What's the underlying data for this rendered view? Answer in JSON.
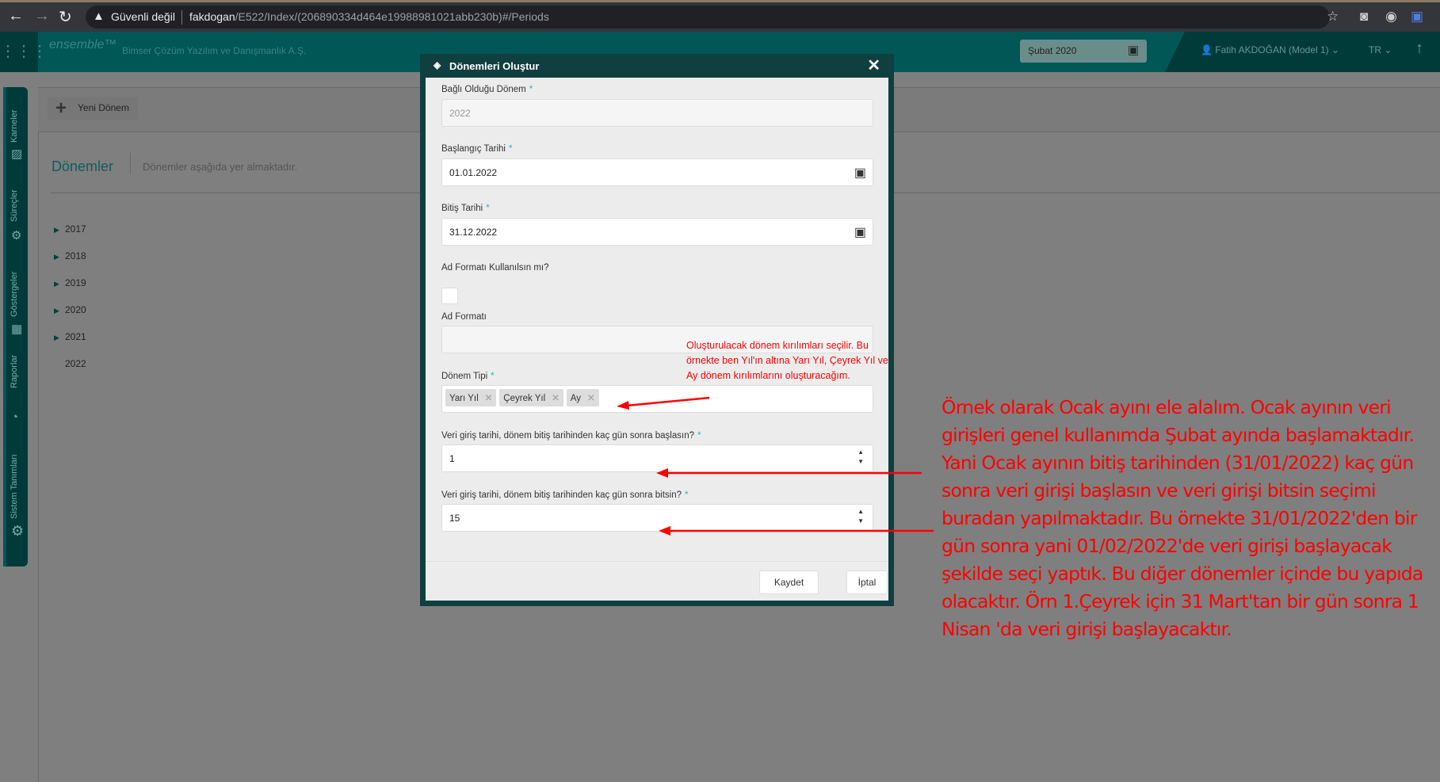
{
  "browser": {
    "security": "Güvenli değil",
    "url_host": "fakdogan",
    "url_path": "/E522/Index/(206890334d464e19988981021abb230b)#/Periods"
  },
  "header": {
    "logo": "ensemble™",
    "company": "Bimser Çözüm Yazılım ve Danışmanlık A.Ş.",
    "period": "Şubat 2020",
    "user": "Fatih AKDOĞAN (Model 1)",
    "lang": "TR"
  },
  "sidebar": {
    "items": [
      {
        "label": "Karneler"
      },
      {
        "label": "Süreçler"
      },
      {
        "label": "Göstergeler"
      },
      {
        "label": "Raporlar"
      },
      {
        "label": "Sistem Tanımları"
      }
    ]
  },
  "page": {
    "new_button": "Yeni Dönem",
    "title": "Dönemler",
    "subtitle": "Dönemler aşağıda yer almaktadır.",
    "tree": [
      "2017",
      "2018",
      "2019",
      "2020",
      "2021",
      "2022"
    ]
  },
  "modal": {
    "title": "Dönemleri Oluştur",
    "parent_label": "Bağlı Olduğu Dönem",
    "parent_value": "2022",
    "start_label": "Başlangıç Tarihi",
    "start_value": "01.01.2022",
    "end_label": "Bitiş Tarihi",
    "end_value": "31.12.2022",
    "use_format_label": "Ad Formatı Kullanılsın mı?",
    "format_label": "Ad Formatı",
    "format_value": "",
    "type_label": "Dönem Tipi",
    "types": [
      "Yarı Yıl",
      "Çeyrek Yıl",
      "Ay"
    ],
    "start_days_label": "Veri giriş tarihi, dönem bitiş tarihinden kaç gün sonra başlasın?",
    "start_days": "1",
    "end_days_label": "Veri giriş tarihi, dönem bitiş tarihinden kaç gün sonra bitsin?",
    "end_days": "15",
    "required": "*",
    "save": "Kaydet",
    "cancel": "İptal"
  },
  "annotations": {
    "small": "Oluşturulacak dönem kırılımları seçilir. Bu örnekte ben Yıl'ın altına Yarı Yıl, Çeyrek Yıl ve Ay dönem kırılımlarını oluşturacağım.",
    "large": "Örnek olarak Ocak ayını ele alalım. Ocak ayının veri girişleri genel kullanımda Şubat ayında başlamaktadır. Yani Ocak ayının bitiş tarihinden (31/01/2022) kaç gün sonra veri girişi başlasın ve veri girişi bitsin seçimi buradan yapılmaktadır. Bu örnekte 31/01/2022'den bir gün sonra yani 01/02/2022'de veri girişi başlayacak şekilde seçi yaptık. Bu diğer dönemler içinde bu yapıda olacaktır. Örn 1.Çeyrek için 31 Mart'tan bir gün sonra 1 Nisan 'da veri girişi başlayacaktır.",
    "color": "#ff0000"
  }
}
